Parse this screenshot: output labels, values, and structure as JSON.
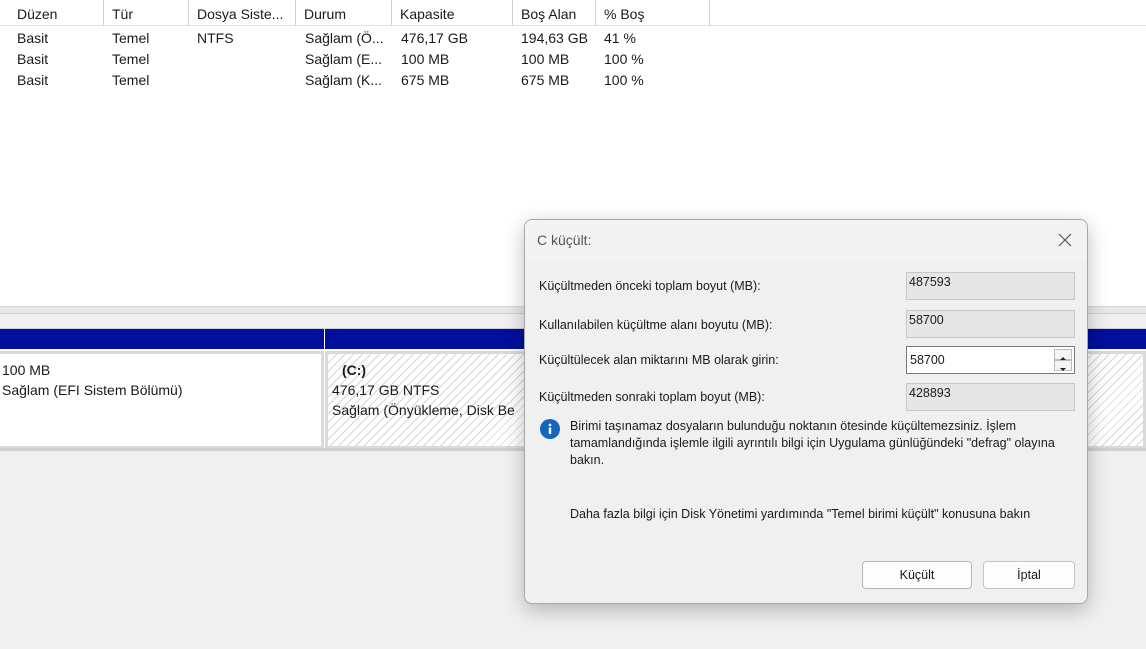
{
  "columns": [
    "Düzen",
    "Tür",
    "Dosya Siste...",
    "Durum",
    "Kapasite",
    "Boş Alan",
    "% Boş"
  ],
  "rows": [
    {
      "duzen": "Basit",
      "tur": "Temel",
      "dosya": "NTFS",
      "durum": "Sağlam (Ö...",
      "kapasite": "476,17 GB",
      "bos": "194,63 GB",
      "yuzde": "41 %"
    },
    {
      "duzen": "Basit",
      "tur": "Temel",
      "dosya": "",
      "durum": "Sağlam (E...",
      "kapasite": "100 MB",
      "bos": "100 MB",
      "yuzde": "100 %"
    },
    {
      "duzen": "Basit",
      "tur": "Temel",
      "dosya": "",
      "durum": "Sağlam (K...",
      "kapasite": "675 MB",
      "bos": "675 MB",
      "yuzde": "100 %"
    }
  ],
  "partitions": {
    "efi": {
      "size": "100 MB",
      "status": "Sağlam (EFI Sistem Bölümü)"
    },
    "c": {
      "name": "(C:)",
      "size": "476,17 GB NTFS",
      "status": "Sağlam (Önyükleme, Disk Be"
    }
  },
  "dialog": {
    "title": "C küçült:",
    "fields": {
      "total_before_label": "Küçültmeden önceki toplam boyut (MB):",
      "total_before_value": "487593",
      "available_label": "Kullanılabilen küçültme alanı boyutu (MB):",
      "available_value": "58700",
      "enter_label": "Küçültülecek alan miktarını MB olarak girin:",
      "enter_value": "58700",
      "total_after_label": "Küçültmeden sonraki toplam boyut (MB):",
      "total_after_value": "428893"
    },
    "info": "Birimi taşınamaz dosyaların bulunduğu noktanın ötesinde küçültemezsiniz. İşlem tamamlandığında işlemle ilgili ayrıntılı bilgi için Uygulama günlüğündeki \"defrag\" olayına bakın.",
    "help": "Daha fazla bilgi için Disk Yönetimi yardımında \"Temel birimi küçült\" konusuna bakın",
    "buttons": {
      "shrink": "Küçült",
      "cancel": "İptal"
    }
  },
  "colors": {
    "partition_bar": "#000f9b",
    "info_icon": "#1565c0"
  },
  "icons": {
    "close": "close-icon",
    "info": "info-icon",
    "spin_up": "chevron-up-icon",
    "spin_down": "chevron-down-icon"
  }
}
